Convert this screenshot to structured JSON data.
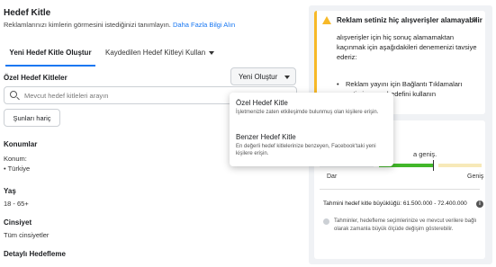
{
  "header": {
    "title": "Hedef Kitle",
    "subtitle": "Reklamlarınızı kimlerin görmesini istediğinizi tanımlayın.",
    "learn_more": "Daha Fazla Bilgi Alın"
  },
  "tabs": [
    {
      "label": "Yeni Hedef Kitle Oluştur"
    },
    {
      "label": "Kaydedilen Hedef Kitleyi Kullan"
    }
  ],
  "custom_audiences": {
    "label": "Özel Hedef Kitleler",
    "create_button": "Yeni Oluştur",
    "search_placeholder": "Mevcut hedef kitleleri arayın",
    "exclude_button": "Şunları hariç"
  },
  "dropdown": {
    "items": [
      {
        "title": "Özel Hedef Kitle",
        "desc": "İşletmenizle zaten etkileşimde bulunmuş olan kişilere erişin."
      },
      {
        "title": "Benzer Hedef Kitle",
        "desc": "En değerli hedef kitlelerinize benzeyen, Facebook'taki yeni kişilere erişin."
      }
    ]
  },
  "locations": {
    "label": "Konumlar",
    "sub": "Konum:",
    "value": "• Türkiye"
  },
  "age": {
    "label": "Yaş",
    "value": "18 - 65+"
  },
  "gender": {
    "label": "Cinsiyet",
    "value": "Tüm cinsiyetler"
  },
  "detailed": {
    "label": "Detaylı Hedefleme"
  },
  "alert": {
    "title": "Reklam setiniz hiç alışverişler alamayabilir",
    "body": "alışverişler için hiç sonuç alamamaktan kaçınmak için aşağıdakileri denemenizi tavsiye ederiz:",
    "bullet": "Reklam yayını için Bağlantı Tıklamaları optimizasyon hedefini kullanın",
    "close": "×"
  },
  "audience_card": {
    "breadth_text": "a geniş.",
    "narrow": "Dar",
    "wide": "Geniş",
    "size_line": "Tahmini hedef kitle büyüklüğü: 61.500.000 - 72.400.000",
    "estimate_note": "Tahminler, hedefleme seçimlerinize ve mevcut verilere bağlı olarak zamanla büyük ölçüde değişim gösterebilir."
  }
}
